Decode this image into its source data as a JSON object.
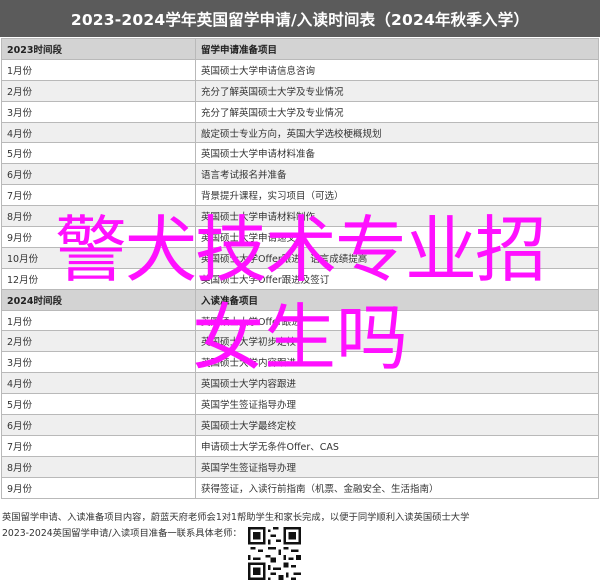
{
  "title": "2023-2024学年英国留学申请/入读时间表（2024年秋季入学）",
  "table": {
    "header1": {
      "period": "2023时间段",
      "item": "留学申请准备项目"
    },
    "rows1": [
      {
        "period": "1月份",
        "item": "英国硕士大学申请信息咨询"
      },
      {
        "period": "2月份",
        "item": "充分了解英国硕士大学及专业情况"
      },
      {
        "period": "3月份",
        "item": "充分了解英国硕士大学及专业情况"
      },
      {
        "period": "4月份",
        "item": "敲定硕士专业方向，英国大学选校梗概规划"
      },
      {
        "period": "5月份",
        "item": "英国硕士大学申请材料准备"
      },
      {
        "period": "6月份",
        "item": "语言考试报名并准备"
      },
      {
        "period": "7月份",
        "item": "背景提升课程，实习项目（可选）"
      },
      {
        "period": "8月份",
        "item": "英国硕士大学申请材料制作"
      },
      {
        "period": "9月份",
        "item": "英国硕士大学申请递交"
      },
      {
        "period": "10月份",
        "item": "英国硕士大学Offer跟进，语言成绩提高"
      },
      {
        "period": "12月份",
        "item": "英国硕士大学Offer跟进及签订"
      }
    ],
    "header2": {
      "period": "2024时间段",
      "item": "入读准备项目"
    },
    "rows2": [
      {
        "period": "1月份",
        "item": "英国硕士大学Offer跟进"
      },
      {
        "period": "2月份",
        "item": "英国硕士大学初步定校"
      },
      {
        "period": "3月份",
        "item": "英国硕士大学内容跟进"
      },
      {
        "period": "4月份",
        "item": "英国硕士大学内容跟进"
      },
      {
        "period": "5月份",
        "item": "英国学生签证指导办理"
      },
      {
        "period": "6月份",
        "item": "英国硕士大学最终定校"
      },
      {
        "period": "7月份",
        "item": "申请硕士大学无条件Offer、CAS"
      },
      {
        "period": "8月份",
        "item": "英国学生签证指导办理"
      },
      {
        "period": "9月份",
        "item": "获得签证，入读行前指南（机票、金融安全、生活指南）"
      }
    ]
  },
  "footer": {
    "line1": "英国留学申请、入读准备项目内容，蔚蓝天府老师会1对1帮助学生和家长完成，以便于同学顺利入读英国硕士大学",
    "line2": "2023-2024英国留学申请/入读项目准备一联系具体老师："
  },
  "overlay": {
    "line1": "警犬技术专业招",
    "line2": "女生吗"
  },
  "colors": {
    "banner": "#5b5b5b",
    "header_row": "#d3d3d3",
    "alt_row": "#efefef",
    "overlay_text": "#ff10ff"
  }
}
